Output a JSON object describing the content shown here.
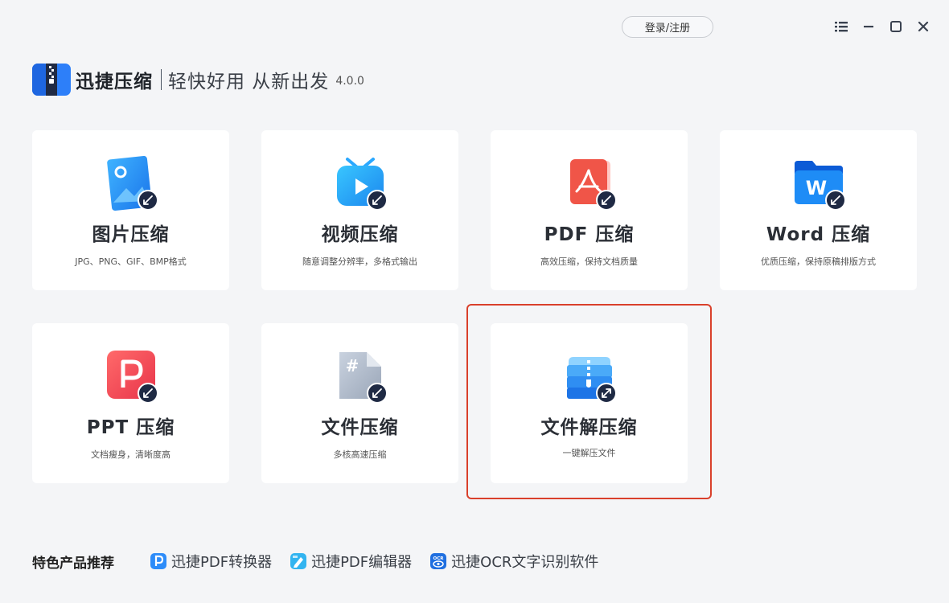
{
  "header": {
    "login_label": "登录/注册"
  },
  "brand": {
    "name": "迅捷压缩",
    "slogan": "轻快好用 从新出发",
    "version": "4.0.0"
  },
  "cards": [
    {
      "title": "图片压缩",
      "desc": "JPG、PNG、GIF、BMP格式",
      "icon": "image-compress-icon"
    },
    {
      "title": "视频压缩",
      "desc": "随意调整分辨率，多格式输出",
      "icon": "video-compress-icon"
    },
    {
      "title": "PDF 压缩",
      "desc": "高效压缩，保持文档质量",
      "icon": "pdf-compress-icon"
    },
    {
      "title": "Word 压缩",
      "desc": "优质压缩，保持原稿排版方式",
      "icon": "word-compress-icon"
    },
    {
      "title": "PPT 压缩",
      "desc": "文档瘦身，清晰度高",
      "icon": "ppt-compress-icon"
    },
    {
      "title": "文件压缩",
      "desc": "多核高速压缩",
      "icon": "file-compress-icon"
    },
    {
      "title": "文件解压缩",
      "desc": "一键解压文件",
      "icon": "file-decompress-icon"
    }
  ],
  "footer": {
    "label": "特色产品推荐",
    "links": [
      {
        "text": "迅捷PDF转换器",
        "icon": "pdf-converter-icon"
      },
      {
        "text": "迅捷PDF编辑器",
        "icon": "pdf-editor-icon"
      },
      {
        "text": "迅捷OCR文字识别软件",
        "icon": "ocr-icon"
      }
    ]
  },
  "colors": {
    "accent_red": "#d9402b",
    "brand_blue": "#2d7ff9",
    "background": "#f4f5f7"
  }
}
